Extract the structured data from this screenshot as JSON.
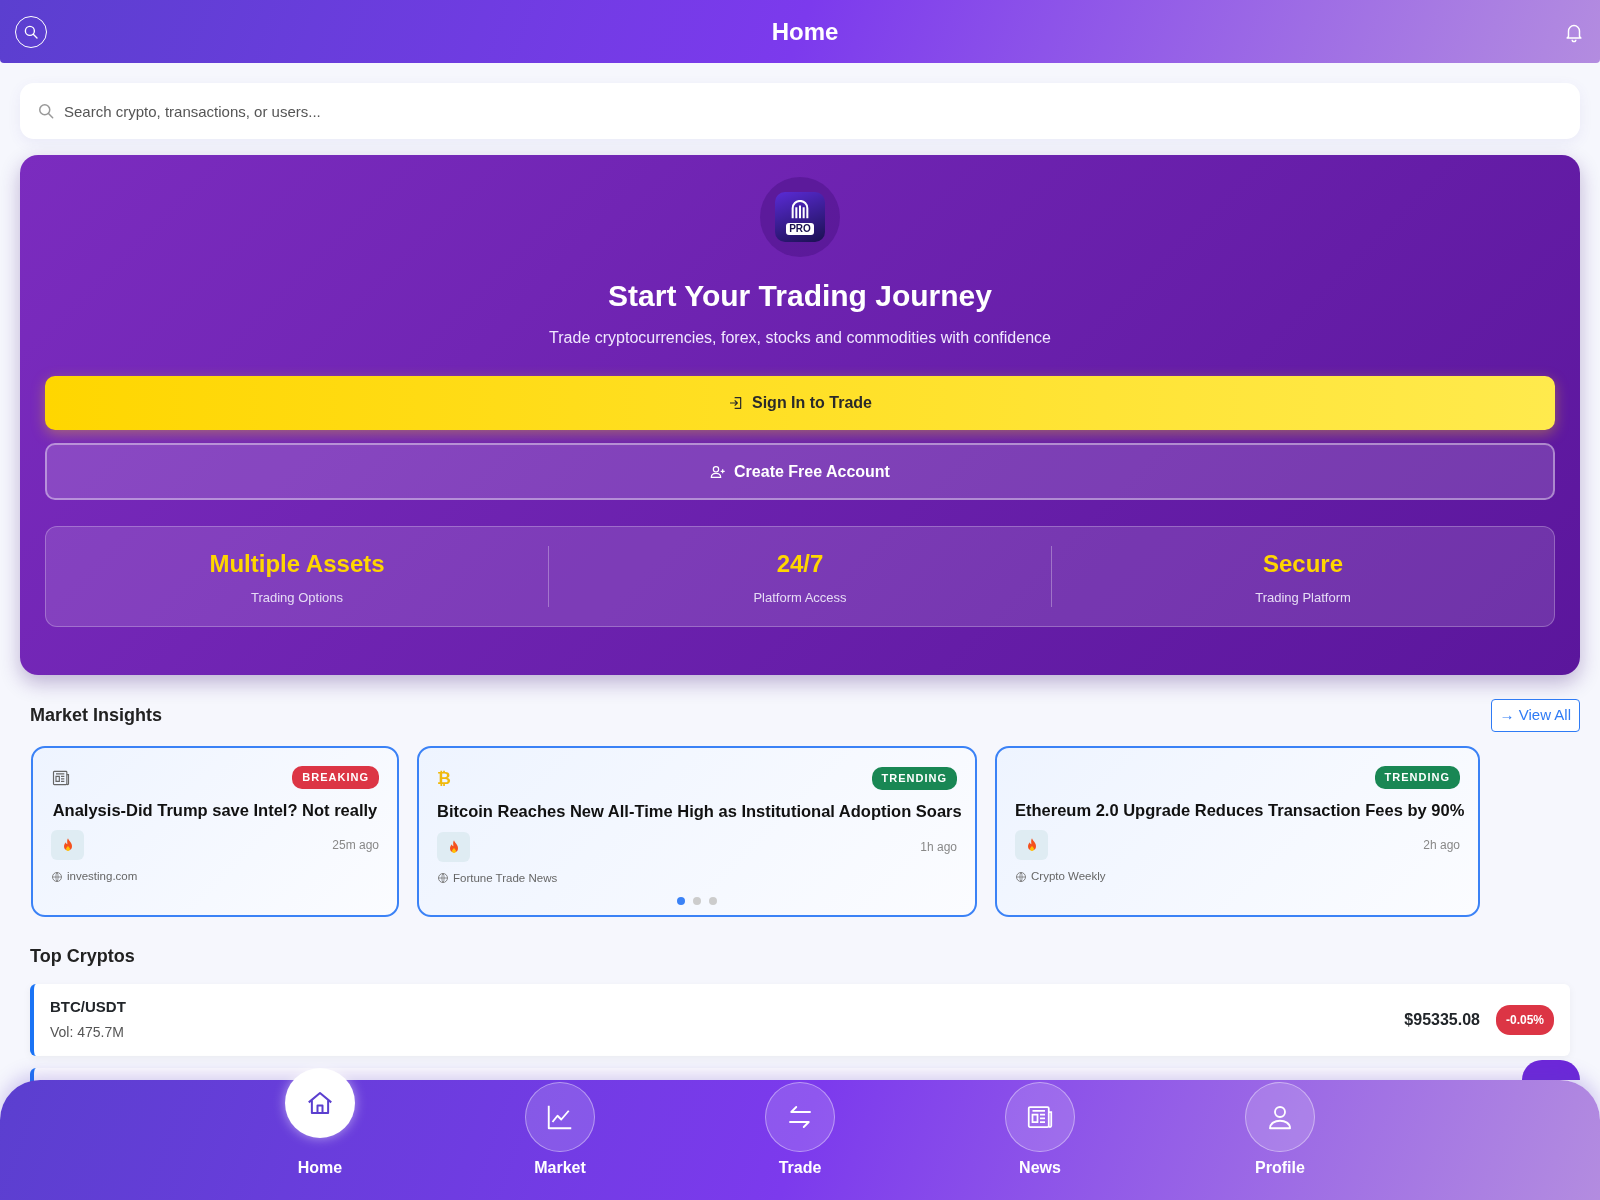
{
  "header": {
    "title": "Home"
  },
  "search": {
    "placeholder": "Search crypto, transactions, or users..."
  },
  "hero": {
    "logo_text": "PRO",
    "title": "Start Your Trading Journey",
    "subtitle": "Trade cryptocurrencies, forex, stocks and commodities with confidence",
    "buttons": [
      {
        "kind": "primary",
        "label": "Sign In to Trade"
      },
      {
        "kind": "outline",
        "label": "Create Free Account"
      }
    ],
    "stats": [
      {
        "value": "Multiple Assets",
        "label": "Trading Options"
      },
      {
        "value": "24/7",
        "label": "Platform Access"
      },
      {
        "value": "Secure",
        "label": "Trading Platform"
      }
    ]
  },
  "insights": {
    "title": "Market Insights",
    "view_all": "→ View All",
    "cards": [
      {
        "kind": "newspaper",
        "tag": {
          "label": "BREAKING",
          "kind": "breaking"
        },
        "title": "Analysis-Did Trump save Intel? Not really",
        "time": "25m ago",
        "source": "investing.com"
      },
      {
        "kind": "bitcoin",
        "icon_text": "₿",
        "tag": {
          "label": "TRENDING",
          "kind": "trending"
        },
        "title": "Bitcoin Reaches New All-Time High as Institutional Adoption Soars",
        "time": "1h ago",
        "source": "Fortune Trade News",
        "dots": [
          {
            "selected": true
          },
          {
            "selected": false
          },
          {
            "selected": false
          }
        ]
      },
      {
        "kind": "plain",
        "tag": {
          "label": "TRENDING",
          "kind": "trending"
        },
        "title": "Ethereum 2.0 Upgrade Reduces Transaction Fees by 90%",
        "time": "2h ago",
        "source": "Crypto Weekly"
      }
    ]
  },
  "top_cryptos": {
    "title": "Top Cryptos",
    "rows": [
      {
        "pair": "BTC/USDT",
        "volume": "Vol: 475.7M",
        "price": "$95335.08",
        "change": "-0.05%",
        "kind": "down"
      }
    ]
  },
  "bottom_nav": [
    {
      "label": "Home",
      "kind": "home",
      "selected": true
    },
    {
      "label": "Market",
      "kind": "chart",
      "selected": false
    },
    {
      "label": "Trade",
      "kind": "swap",
      "selected": false
    },
    {
      "label": "News",
      "kind": "newspaper",
      "selected": false
    },
    {
      "label": "Profile",
      "kind": "person",
      "selected": false
    }
  ]
}
